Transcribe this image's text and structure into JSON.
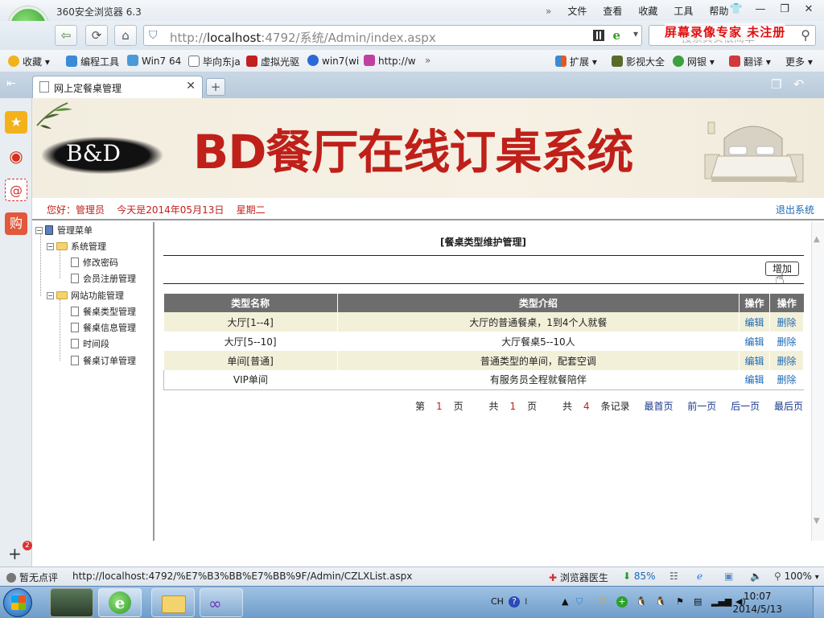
{
  "browser": {
    "title": "360安全浏览器 6.3",
    "menus": [
      "文件",
      "查看",
      "收藏",
      "工具",
      "帮助"
    ],
    "url_prefix": "http://",
    "url_host": "localhost",
    "url_rest": ":4792/系统/Admin/index.aspx",
    "search_placeholder": "搜索其实很简单",
    "watermark": "屏幕录像专家 未注册"
  },
  "bookmarks": [
    {
      "label": "收藏",
      "icon": "star-icon",
      "color": "#f2b21a"
    },
    {
      "label": "编程工具",
      "icon": "bookmark-app-icon",
      "color": "#3a8ad8"
    },
    {
      "label": "Win7 64",
      "icon": "windows-icon",
      "color": "#4a9ad8"
    },
    {
      "label": "毕向东ja",
      "icon": "page-icon",
      "color": "#ffffff"
    },
    {
      "label": "虚拟光驱",
      "icon": "disc-icon",
      "color": "#c02020"
    },
    {
      "label": "win7(wi",
      "icon": "ie-icon",
      "color": "#2a6ad8"
    },
    {
      "label": "http://w",
      "icon": "link-icon",
      "color": "#c040a0"
    }
  ],
  "toolbar_right": [
    {
      "label": "扩展",
      "icon": "extensions-icon"
    },
    {
      "label": "影视大全",
      "icon": "video-icon"
    },
    {
      "label": "网银",
      "icon": "bank-icon"
    },
    {
      "label": "翻译",
      "icon": "translate-icon"
    },
    {
      "label": "更多",
      "icon": "more-icon"
    }
  ],
  "tab": {
    "label": "网上定餐桌管理"
  },
  "site": {
    "logo_text": "B&D",
    "banner_title": "BD餐厅在线订桌系统",
    "greeting": "您好：管理员    今天是2014年05月13日    星期二",
    "logout": "退出系统"
  },
  "tree": {
    "root": "管理菜单",
    "groups": [
      {
        "label": "系统管理",
        "items": [
          "修改密码",
          "会员注册管理"
        ]
      },
      {
        "label": "网站功能管理",
        "items": [
          "餐桌类型管理",
          "餐桌信息管理",
          "时间段",
          "餐桌订单管理"
        ]
      }
    ]
  },
  "main": {
    "title": "[餐桌类型维护管理]",
    "add_button": "增加",
    "columns": [
      "类型名称",
      "类型介绍",
      "操作",
      "操作"
    ],
    "rows": [
      {
        "name": "大厅[1--4]",
        "desc": "大厅的普通餐桌，1到4个人就餐",
        "edit": "编辑",
        "delete": "删除"
      },
      {
        "name": "大厅[5--10]",
        "desc": "大厅餐桌5--10人",
        "edit": "编辑",
        "delete": "删除"
      },
      {
        "name": "单间[普通]",
        "desc": "普通类型的单间，配套空调",
        "edit": "编辑",
        "delete": "删除"
      },
      {
        "name": "VIP单间",
        "desc": "有服务员全程就餐陪伴",
        "edit": "编辑",
        "delete": "删除"
      }
    ],
    "pager": {
      "page_pre": "第",
      "page_num": "1",
      "page_post": "页",
      "total_pre": "共",
      "total_num": "1",
      "total_post": "页",
      "rec_pre": "共",
      "rec_num": "4",
      "rec_post": "条记录",
      "first": "最首页",
      "prev": "前一页",
      "next": "后一页",
      "last": "最后页"
    }
  },
  "status": {
    "review": "暂无点评",
    "link": "http://localhost:4792/%E7%B3%BB%E7%BB%9F/Admin/CZLXList.aspx",
    "doctor": "浏览器医生",
    "download": "85%",
    "zoom": "100%",
    "notify_count": "2"
  },
  "taskbar": {
    "ime": "CH",
    "time": "10:07",
    "date": "2014/5/13"
  }
}
